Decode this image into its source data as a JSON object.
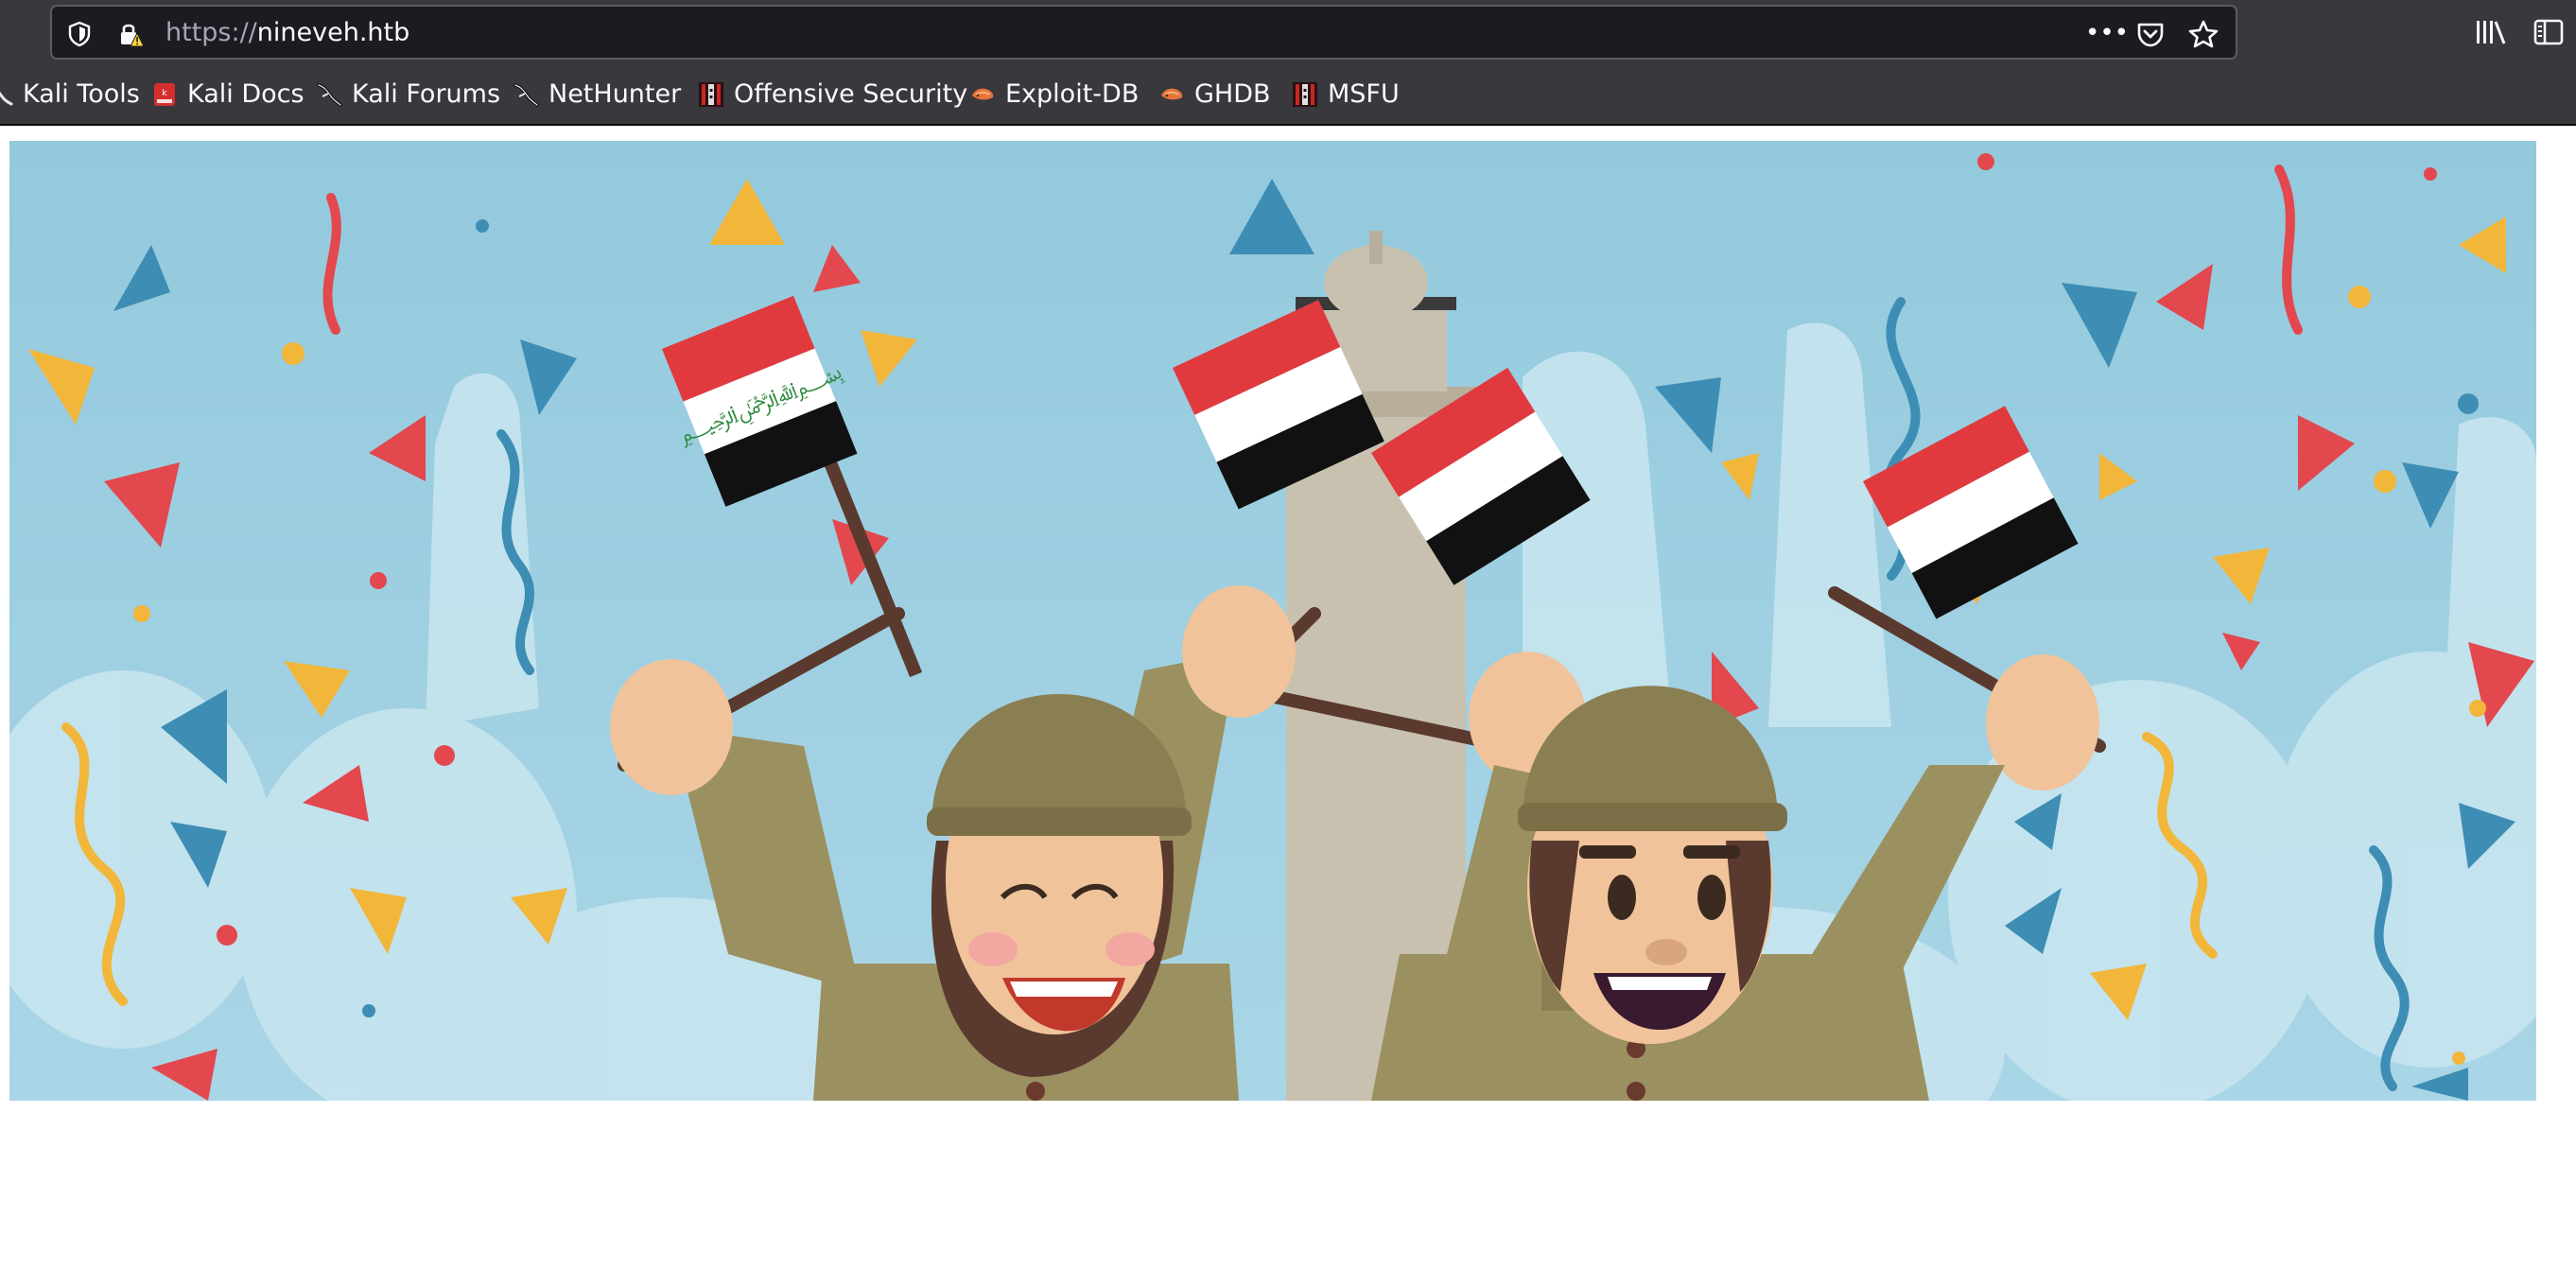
{
  "browser": {
    "url_scheme": "https://",
    "url_host": "nineveh.htb",
    "page_actions_label": "•••"
  },
  "bookmarks": [
    {
      "label": "Kali Tools",
      "icon": "kali-dragon-icon"
    },
    {
      "label": "Kali Docs",
      "icon": "kali-docs-icon"
    },
    {
      "label": "Kali Forums",
      "icon": "kali-dragon-icon"
    },
    {
      "label": "NetHunter",
      "icon": "kali-dragon-icon"
    },
    {
      "label": "Offensive Security",
      "icon": "offsec-icon"
    },
    {
      "label": "Exploit-DB",
      "icon": "exploitdb-icon"
    },
    {
      "label": "GHDB",
      "icon": "exploitdb-icon"
    },
    {
      "label": "MSFU",
      "icon": "offsec-icon"
    }
  ],
  "colors": {
    "chrome_bg": "#38383d",
    "urlbar_bg": "#1c1b22",
    "text": "#fbfbfe",
    "sky": "#9fcfe0",
    "flag_red": "#e03a3e",
    "flag_black": "#111111",
    "uniform": "#9b9060",
    "helmet": "#8a7f52"
  },
  "hero_image": {
    "subject": "cartoon celebration with two soldiers waving Iraqi flags"
  }
}
